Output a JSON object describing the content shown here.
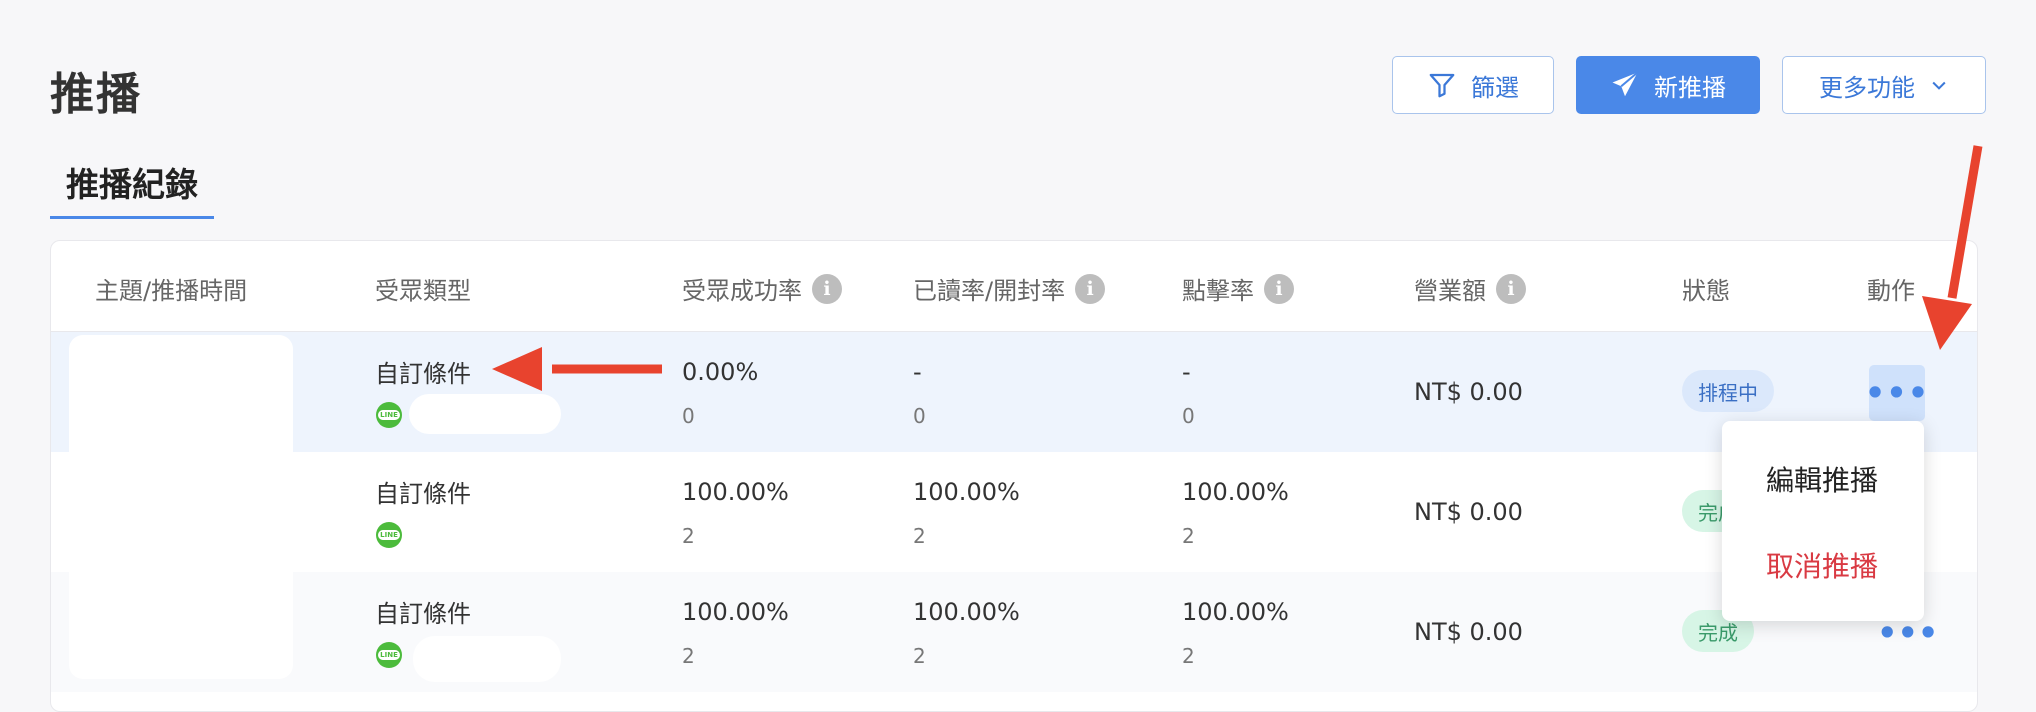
{
  "header": {
    "title": "推播",
    "filter_label": "篩選",
    "new_label": "新推播",
    "more_label": "更多功能"
  },
  "tab": {
    "label": "推播紀錄"
  },
  "table": {
    "columns": [
      "主題/推播時間",
      "受眾類型",
      "受眾成功率",
      "已讀率/開封率",
      "點擊率",
      "營業額",
      "狀態",
      "動作"
    ],
    "rows": [
      {
        "audience": "自訂條件",
        "success": "0.00%",
        "success_count": "0",
        "read": "-",
        "read_count": "0",
        "click": "-",
        "click_count": "0",
        "revenue": "NT$ 0.00",
        "status": "排程中"
      },
      {
        "audience": "自訂條件",
        "success": "100.00%",
        "success_count": "2",
        "read": "100.00%",
        "read_count": "2",
        "click": "100.00%",
        "click_count": "2",
        "revenue": "NT$ 0.00",
        "status": "完成"
      },
      {
        "audience": "自訂條件",
        "success": "100.00%",
        "success_count": "2",
        "read": "100.00%",
        "read_count": "2",
        "click": "100.00%",
        "click_count": "2",
        "revenue": "NT$ 0.00",
        "status": "完成"
      }
    ]
  },
  "dropdown": {
    "edit": "編輯推播",
    "cancel": "取消推播"
  },
  "icons": {
    "filter": "filter-icon",
    "send": "paper-plane-icon",
    "chevron": "chevron-down-icon",
    "info": "info-icon",
    "line": "line-app-icon",
    "more": "more-dots-icon"
  },
  "colors": {
    "accent": "#4a88e8",
    "danger": "#d93a43",
    "annotation_arrow": "#e8432e"
  }
}
